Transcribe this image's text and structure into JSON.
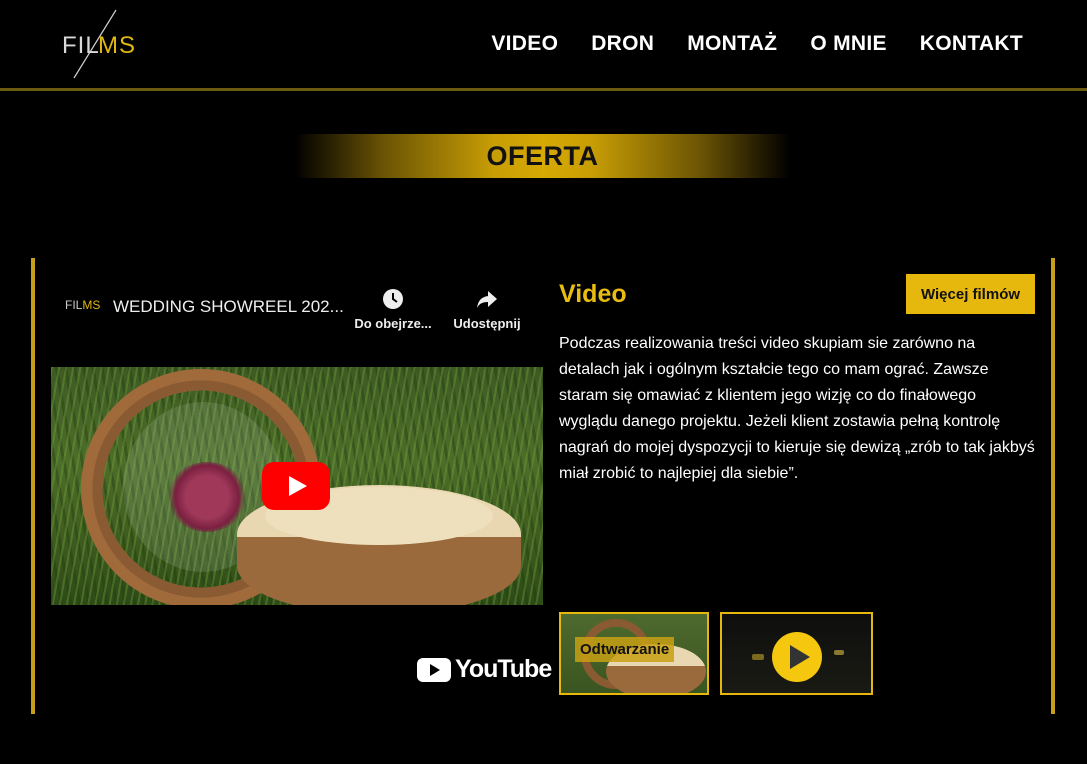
{
  "logo": {
    "part1": "FIL",
    "part2": "MS"
  },
  "nav": [
    "VIDEO",
    "DRON",
    "MONTAŻ",
    "O MNIE",
    "KONTAKT"
  ],
  "banner": "OFERTA",
  "embed": {
    "channel_logo": {
      "part1": "FIL",
      "part2": "MS"
    },
    "video_title": "WEDDING SHOWREEL 202...",
    "watch_later": "Do obejrze...",
    "share": "Udostępnij",
    "youtube": "YouTube"
  },
  "section": {
    "title": "Video",
    "more_button": "Więcej filmów",
    "description": "Podczas realizowania treści video skupiam sie zarówno na detalach jak i ogólnym kształcie tego co mam ograć. Zawsze staram się omawiać z klientem jego wizję co do finałowego wyglądu danego projektu. Jeżeli klient zostawia pełną kontrolę nagrań do mojej dyspozycji to kieruje się dewizą „zrób to tak jakbyś miał zrobić to najlepiej dla siebie”."
  },
  "thumbnails": [
    {
      "label": "Odtwarzanie"
    },
    {
      "label": ""
    }
  ],
  "colors": {
    "accent": "#e6b80e",
    "line": "#c7a017",
    "background": "#000000"
  }
}
